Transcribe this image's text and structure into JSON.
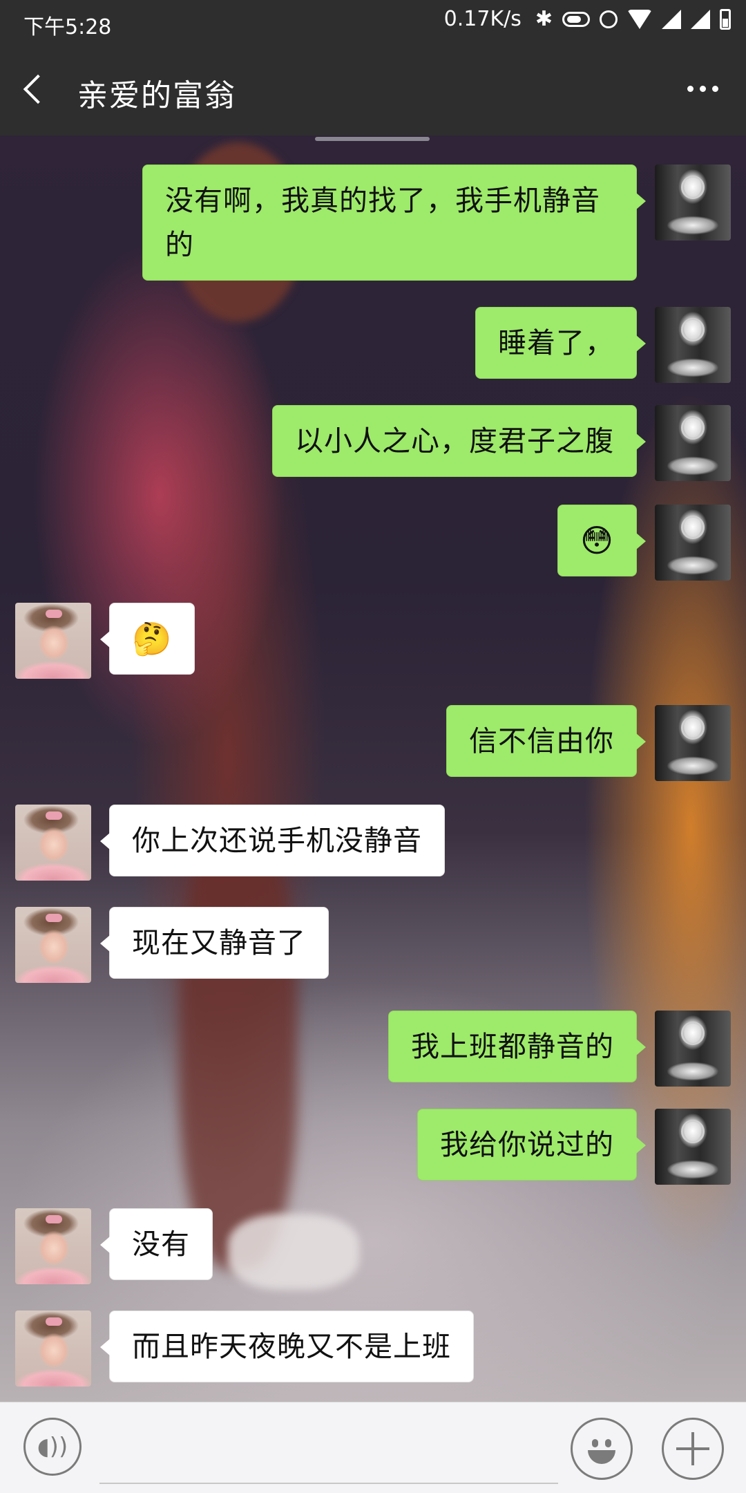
{
  "status_bar": {
    "time": "下午5:28",
    "network_speed": "0.17K/s",
    "icons": [
      "bluetooth-icon",
      "battery-saver-icon",
      "alarm-icon",
      "wifi-icon",
      "signal-icon",
      "signal-icon",
      "battery-icon"
    ]
  },
  "header": {
    "title": "亲爱的富翁",
    "back_icon": "chevron-left-icon",
    "more_icon": "more-icon"
  },
  "messages": [
    {
      "sender": "self",
      "text": "没有啊，我真的找了，我手机静音的"
    },
    {
      "sender": "self",
      "text": "睡着了，"
    },
    {
      "sender": "self",
      "text": "以小人之心，度君子之腹"
    },
    {
      "sender": "self",
      "text": "😳",
      "type": "emoji"
    },
    {
      "sender": "other",
      "text": "🤔",
      "type": "emoji"
    },
    {
      "sender": "self",
      "text": "信不信由你"
    },
    {
      "sender": "other",
      "text": "你上次还说手机没静音"
    },
    {
      "sender": "other",
      "text": "现在又静音了"
    },
    {
      "sender": "self",
      "text": "我上班都静音的"
    },
    {
      "sender": "self",
      "text": "我给你说过的"
    },
    {
      "sender": "other",
      "text": "没有"
    },
    {
      "sender": "other",
      "text": "而且昨天夜晚又不是上班"
    }
  ],
  "input_bar": {
    "text_value": "",
    "voice_icon": "voice-icon",
    "emoji_icon": "emoji-icon",
    "add_icon": "plus-icon"
  },
  "colors": {
    "sent_bubble": "#9eea6a",
    "received_bubble": "#ffffff",
    "header_bg": "#2e2e2e"
  }
}
